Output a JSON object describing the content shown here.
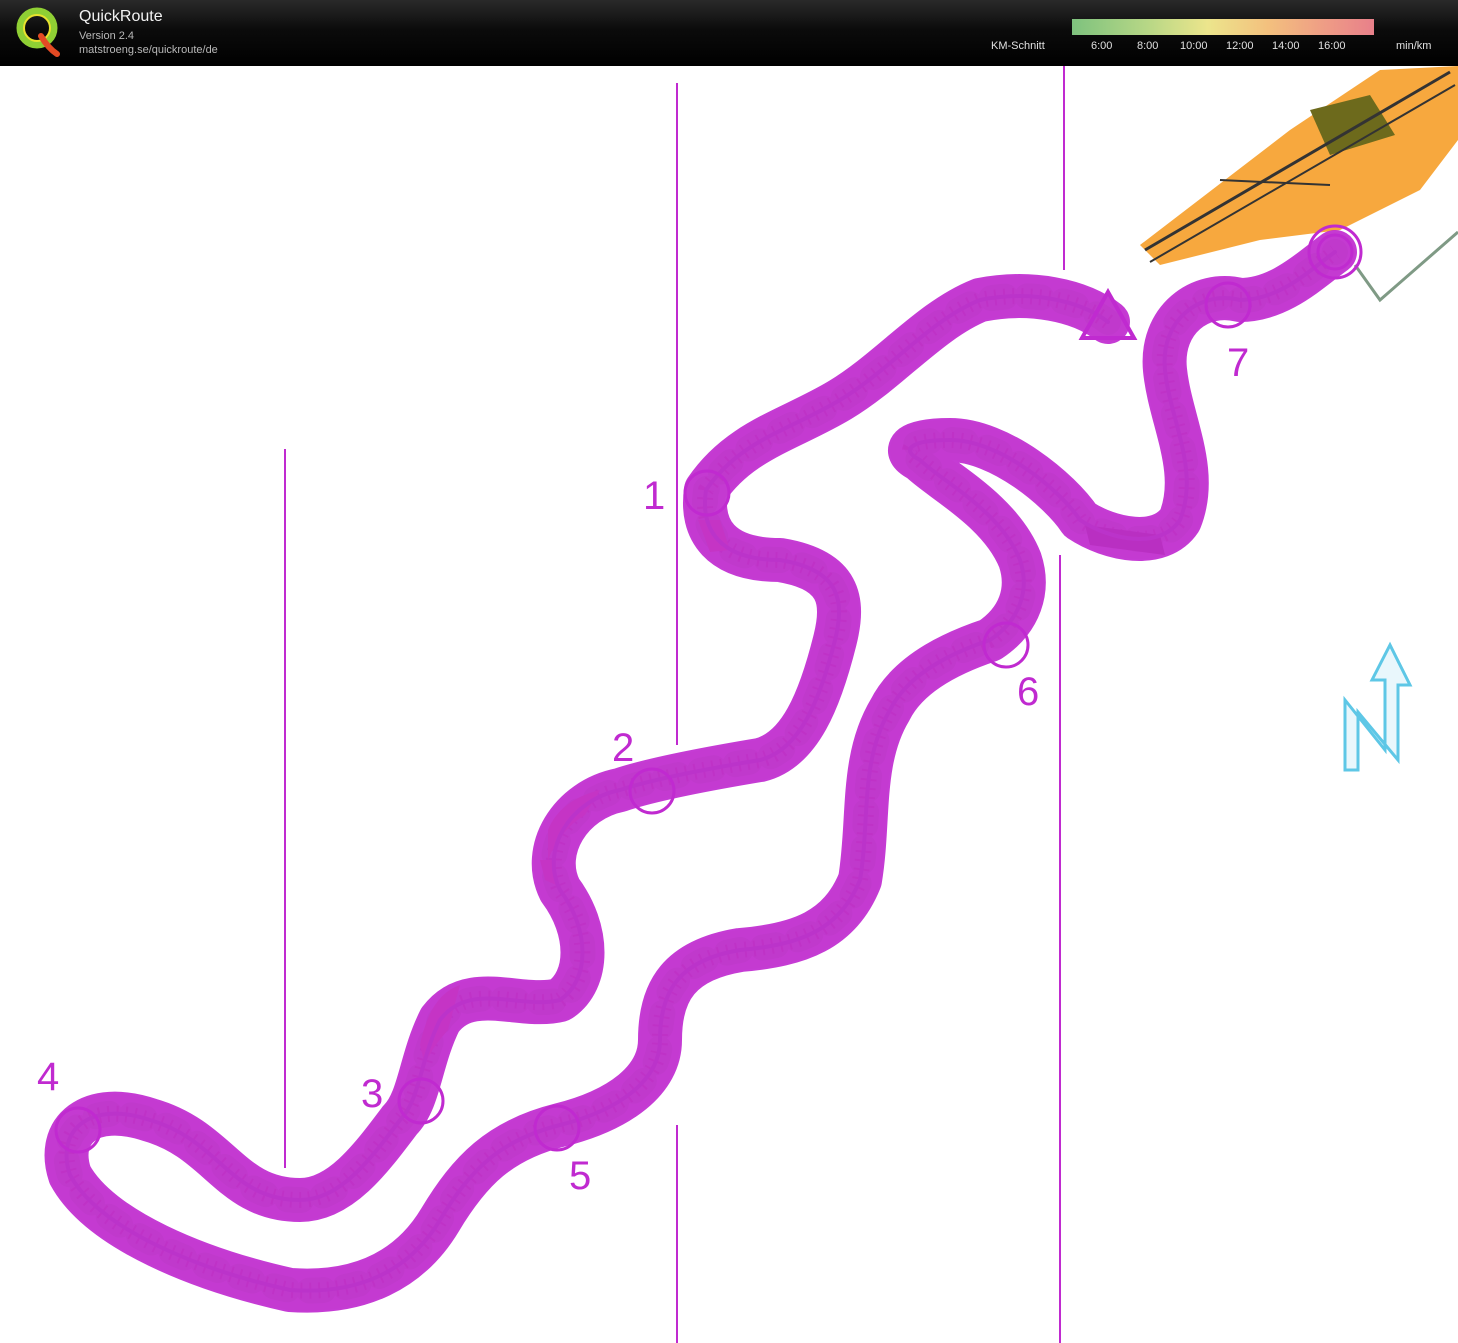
{
  "app": {
    "title": "QuickRoute",
    "version": "Version 2.4",
    "url": "matstroeng.se/quickroute/de"
  },
  "legend": {
    "caption": "KM-Schnitt",
    "unit": "min/km",
    "ticks": [
      "6:00",
      "8:00",
      "10:00",
      "12:00",
      "14:00",
      "16:00"
    ]
  },
  "controls": [
    "1",
    "2",
    "3",
    "4",
    "5",
    "6",
    "7"
  ],
  "colors": {
    "course": "#c02ad0",
    "route": "#7f9a85",
    "open_land": "#f7a83e",
    "forest_green": "#8fd66a",
    "north_arrow": "#5ec7e6"
  },
  "icons": {
    "logo": "quickroute-logo-icon",
    "north": "north-arrow-icon"
  }
}
